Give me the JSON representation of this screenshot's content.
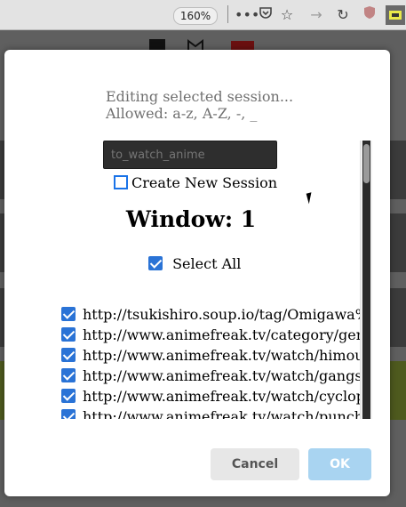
{
  "toolbar": {
    "zoom": "160%",
    "icons": [
      "more-icon",
      "pocket-icon",
      "bookmark-star-icon",
      "forward-icon",
      "reload-icon",
      "ublock-icon",
      "session-ext-icon"
    ]
  },
  "dialog": {
    "hint_line1": "Editing selected session...",
    "hint_line2": "Allowed: a-z, A-Z, -, _",
    "session_input": {
      "value": "",
      "placeholder": "to_watch_anime"
    },
    "create_new_label": "Create New Session",
    "window_title": "Window: 1",
    "select_all_label": "Select All",
    "urls": [
      "http://tsukishiro.soup.io/tag/Omigawa%",
      "http://www.animefreak.tv/category/gen",
      "http://www.animefreak.tv/watch/himou",
      "http://www.animefreak.tv/watch/gangst",
      "http://www.animefreak.tv/watch/cyclop",
      "http://www.animefreak.tv/watch/punch-"
    ],
    "cancel_label": "Cancel",
    "ok_label": "OK"
  },
  "colors": {
    "checkbox": "#2a73d6",
    "ok_button": "#a9d4f1",
    "cancel_button": "#e7e7e7",
    "input_bg": "#2e2e2e"
  }
}
